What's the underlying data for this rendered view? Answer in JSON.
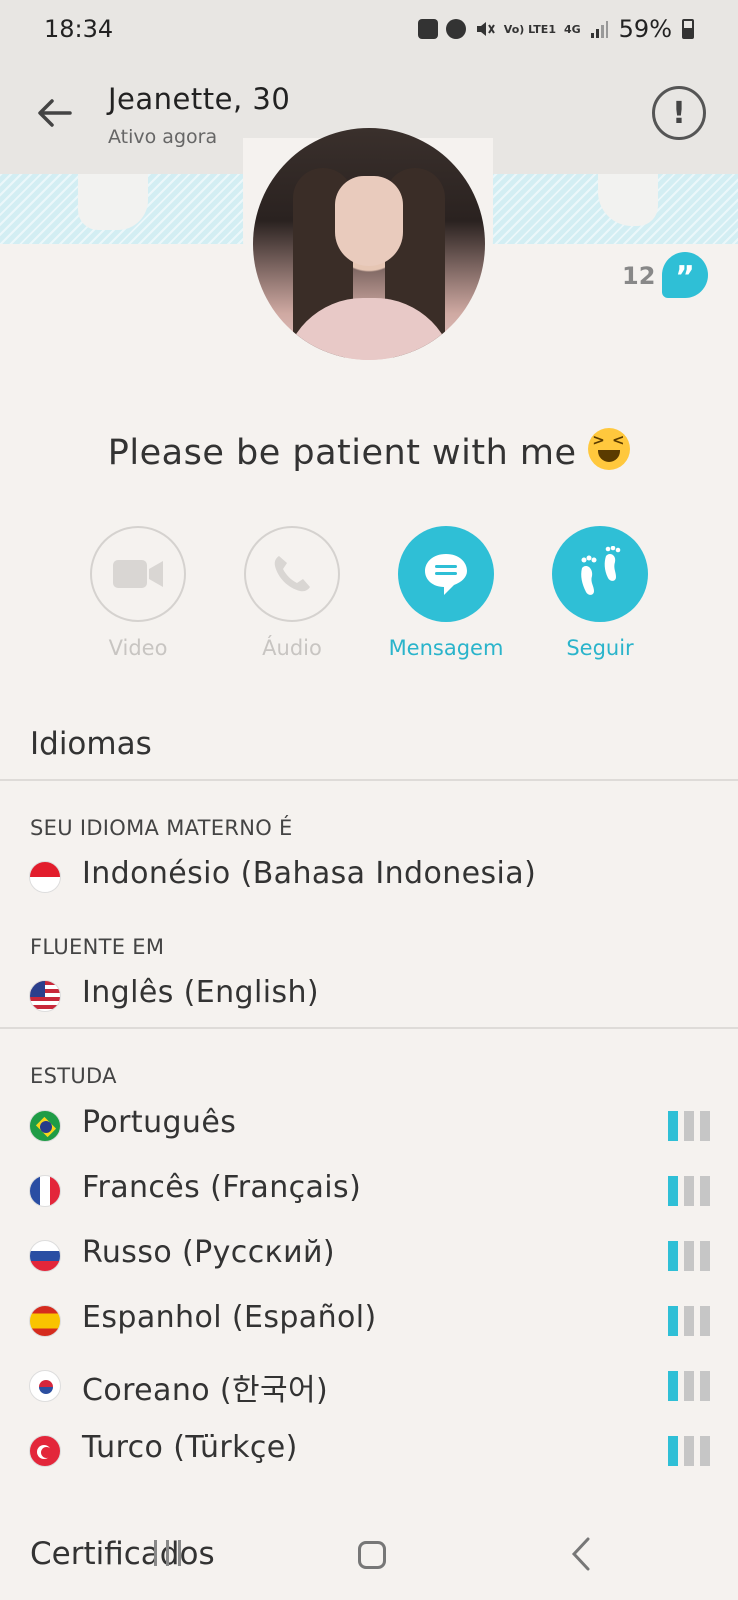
{
  "status_bar": {
    "time": "18:34",
    "battery_text": "59%",
    "icons": [
      "notification-icon",
      "alarm-icon",
      "mute-icon",
      "volte-icon",
      "4g-icon",
      "signal-icon",
      "battery-icon"
    ],
    "volte_text": "Vo) LTE1",
    "network_text": "4G"
  },
  "header": {
    "title": "Jeanette, 30",
    "subtitle": "Ativo agora",
    "report_symbol": "!"
  },
  "profile": {
    "reference_count": "12",
    "reference_symbol": "”",
    "bio": "Please be patient with me",
    "bio_emoji": "grinning-squinting-face"
  },
  "actions": [
    {
      "label": "Video",
      "icon": "video-icon",
      "enabled": false
    },
    {
      "label": "Áudio",
      "icon": "phone-icon",
      "enabled": false
    },
    {
      "label": "Mensagem",
      "icon": "chat-bubble-icon",
      "enabled": true
    },
    {
      "label": "Seguir",
      "icon": "footprints-icon",
      "enabled": true
    }
  ],
  "languages": {
    "title": "Idiomas",
    "native_label": "SEU IDIOMA MATERNO É",
    "native": {
      "name": "Indonésio (Bahasa Indonesia)",
      "flag": "flag-indonesia"
    },
    "fluent_label": "FLUENTE EM",
    "fluent": {
      "name": "Inglês (English)",
      "flag": "flag-usa"
    },
    "studying_label": "ESTUDA",
    "studying": [
      {
        "name": "Português",
        "flag": "flag-brazil",
        "level": 1
      },
      {
        "name": "Francês (Français)",
        "flag": "flag-france",
        "level": 1
      },
      {
        "name": "Russo (Русский)",
        "flag": "flag-russia",
        "level": 1
      },
      {
        "name": "Espanhol (Español)",
        "flag": "flag-spain",
        "level": 1
      },
      {
        "name": "Coreano (한국어)",
        "flag": "flag-south-korea",
        "level": 1
      },
      {
        "name": "Turco (Türkçe)",
        "flag": "flag-turkey",
        "level": 1
      }
    ],
    "level_max": 3
  },
  "certificates": {
    "title": "Certificados"
  },
  "colors": {
    "accent": "#2fbfd6",
    "background": "#f5f2ef",
    "header_bg": "#e8e6e3",
    "disabled": "#c8c5c2"
  },
  "nav": [
    "recent-apps",
    "home",
    "back"
  ]
}
